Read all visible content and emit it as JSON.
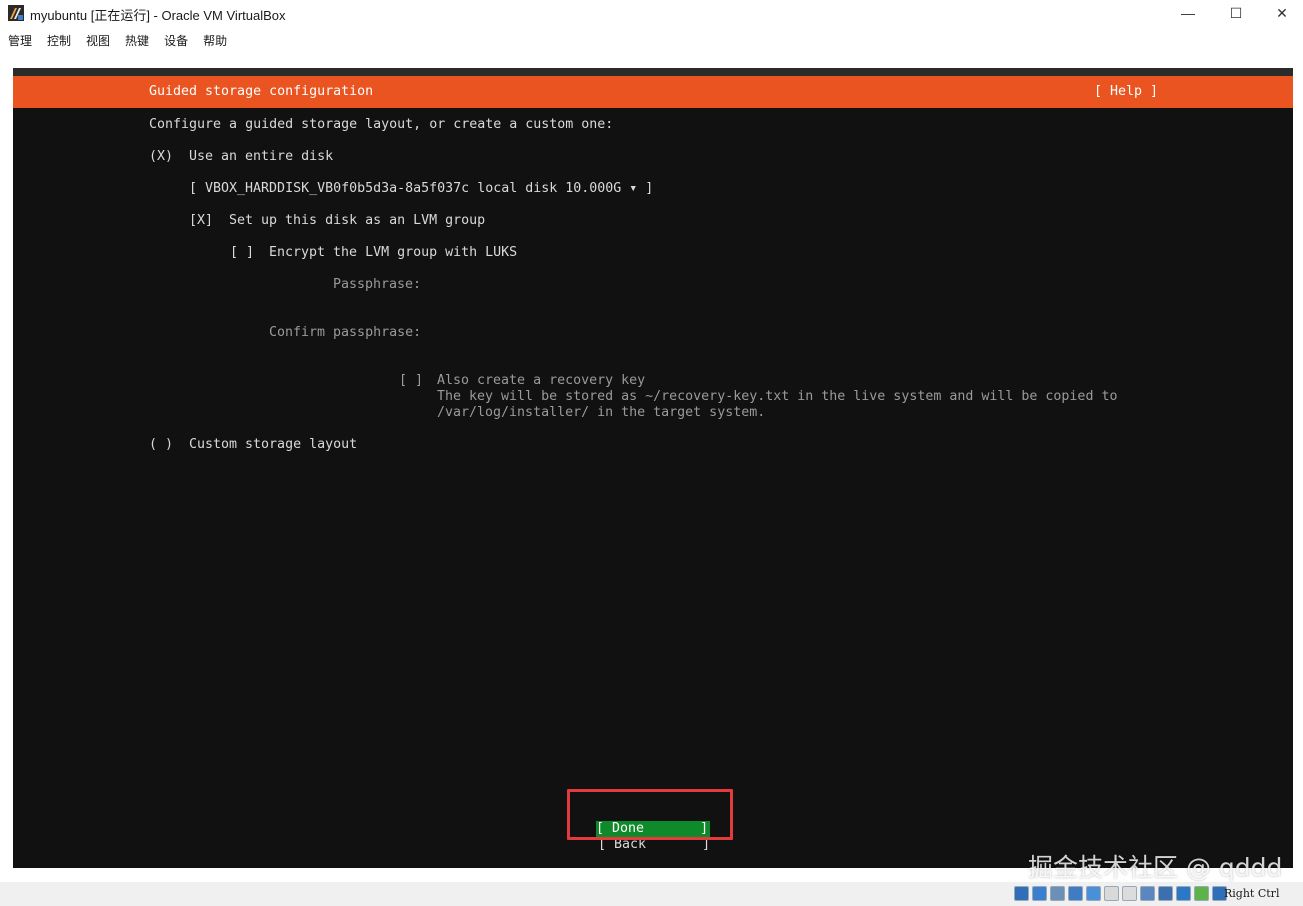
{
  "window": {
    "title": "myubuntu [正在运行] - Oracle VM VirtualBox",
    "controls": {
      "minimize": "—",
      "maximize": "☐",
      "close": "✕"
    }
  },
  "menu": [
    "管理",
    "控制",
    "视图",
    "热键",
    "设备",
    "帮助"
  ],
  "installer": {
    "header_title": "Guided storage configuration",
    "help_label": "[ Help ]",
    "prompt": "Configure a guided storage layout, or create a custom one:",
    "use_entire_disk": {
      "marker": "(X)",
      "label": "Use an entire disk"
    },
    "disk_select": "[ VBOX_HARDDISK_VB0f0b5d3a-8a5f037c local disk 10.000G ▾ ]",
    "lvm": {
      "marker": "[X]",
      "label": "Set up this disk as an LVM group"
    },
    "encrypt": {
      "marker": "[ ]",
      "label": "Encrypt the LVM group with LUKS"
    },
    "passphrase_label": "Passphrase:",
    "confirm_passphrase_label": "Confirm passphrase:",
    "recovery": {
      "marker": "[ ]",
      "label": "Also create a recovery key",
      "desc_line1": "The key will be stored as ~/recovery-key.txt in the live system and will be copied to",
      "desc_line2": "/var/log/installer/ in the target system."
    },
    "custom_layout": {
      "marker": "( )",
      "label": "Custom storage layout"
    },
    "done_button": "[ Done       ]",
    "back_button": "[ Back       ]"
  },
  "watermark": "掘金技术社区 @ qddd",
  "status": {
    "host_key": "Right Ctrl",
    "icons": [
      "hard-disk-icon",
      "optical-disk-icon",
      "audio-icon",
      "network-icon",
      "usb-icon",
      "shared-folder-icon",
      "display-icon",
      "screen-capture-icon",
      "recording-icon",
      "cpu-icon",
      "mouse-integration-icon",
      "keyboard-capture-icon"
    ],
    "icon_colors": [
      "#2f6fb7",
      "#3a7fcf",
      "#6b8fb5",
      "#3f7cc4",
      "#4a90d9",
      "#d9d9d9",
      "#dcdcdc",
      "#5a86c1",
      "#3b6fae",
      "#2a78c6",
      "#5bb34a",
      "#2f6fb7"
    ]
  },
  "colors": {
    "header_orange": "#e95420",
    "done_green": "#0e8a2a",
    "highlight_red": "#e33b3b",
    "screen_bg": "#111111"
  }
}
